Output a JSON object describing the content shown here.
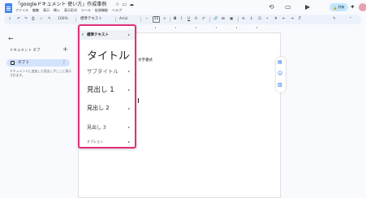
{
  "app": {
    "title": "「googleドキュメント 使い方」作成事例",
    "title_icons": [
      "star-icon",
      "folder-icon",
      "cloud-icon"
    ],
    "menu": [
      "ファイル",
      "編集",
      "表示",
      "挿入",
      "表示形式",
      "ツール",
      "拡張機能",
      "ヘルプ"
    ]
  },
  "header_right": {
    "share_label": "共有",
    "icons": [
      "history-icon",
      "comment-icon",
      "video-icon",
      "gemini-icon"
    ]
  },
  "toolbar": {
    "zoom": "100%",
    "style_select": "標準テキスト",
    "font_select": "Arial",
    "font_size": "11",
    "minus": "−",
    "plus": "+",
    "bold": "B",
    "italic": "I",
    "underline": "U",
    "text_color": "A"
  },
  "sidebar": {
    "header": "ドキュメント タブ",
    "tab_label": "タブ 1",
    "description": "ドキュメントに追加した見出しがここに表示されます。"
  },
  "document": {
    "text": "文字書式"
  },
  "style_menu": {
    "items": [
      {
        "label": "標準テキスト",
        "checked": true
      },
      {
        "label": "タイトル"
      },
      {
        "label": "サブタイトル"
      },
      {
        "label": "見出し 1"
      },
      {
        "label": "見出し 2"
      },
      {
        "label": "見出し 3"
      },
      {
        "label": "オプション"
      }
    ],
    "highlight_color": "#e0317a"
  }
}
